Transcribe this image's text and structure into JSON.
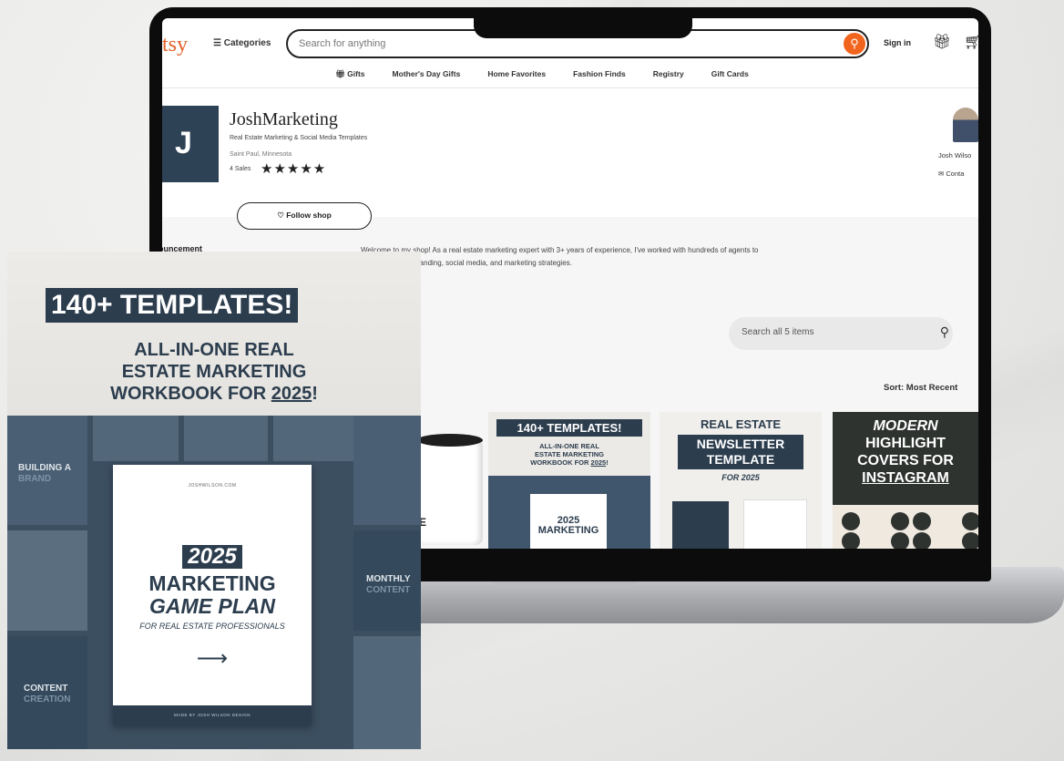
{
  "header": {
    "logo": "tsy",
    "categories_label": "Categories",
    "search_placeholder": "Search for anything",
    "sign_in": "Sign in"
  },
  "nav": {
    "items": [
      "Gifts",
      "Mother's Day Gifts",
      "Home Favorites",
      "Fashion Finds",
      "Registry",
      "Gift Cards"
    ]
  },
  "shop": {
    "logo_letter": "J",
    "name": "JoshMarketing",
    "tagline": "Real Estate Marketing & Social Media Templates",
    "location": "Saint Paul, Minnesota",
    "sales": "4 Sales",
    "stars": "★★★★★",
    "rating": 5,
    "owner_name": "Josh Wilso",
    "contact": "Conta",
    "follow_label": "Follow shop",
    "announcement_label": "ouncement",
    "welcome_line1": "Welcome to my shop! As a real estate marketing expert with 3+ years of experience, I've worked with hundreds of agents to",
    "welcome_line2": "randing, social media, and marketing strategies.",
    "items_search_placeholder": "Search all 5 items",
    "sort_label": "Sort: Most Recent"
  },
  "thumbnails": {
    "t1_title": "140+ TEMPLATES!",
    "t1_sub1": "ALL-IN-ONE REAL",
    "t1_sub2": "ESTATE MARKETING",
    "t1_sub3": "WORKBOOK FOR",
    "t1_year": "2025",
    "t1_excl": "!",
    "t1_doc1": "2025",
    "t1_doc2": "MARKETING",
    "t2_a": "REAL ESTATE",
    "t2_b1": "NEWSLETTER",
    "t2_b2": "TEMPLATE",
    "t2_c": "FOR 2025",
    "t3_a": "MODERN",
    "t3_b1": "HIGHLIGHT",
    "t3_b2": "COVERS FOR",
    "t3_u": "INSTAGRAM",
    "mug_text": "E"
  },
  "card": {
    "headline": "140+ TEMPLATES!",
    "line1": "ALL-IN-ONE REAL",
    "line2": "ESTATE MARKETING",
    "line3_prefix": "WORKBOOK FOR ",
    "line3_year": "2025",
    "line3_suffix": "!",
    "side_building": "BUILDING A",
    "side_brand": "BRAND",
    "side_monthly": "MONTHLY",
    "side_content_r": "CONTENT",
    "side_content_l": "CONTENT",
    "side_creation": "CREATION",
    "paper_site": "JOSHWILSON.COM",
    "paper_year": "2025",
    "paper_marketing": "MARKETING",
    "paper_gameplan": "GAME PLAN",
    "paper_for": "FOR REAL ESTATE PROFESSIONALS",
    "paper_arrow": "⟶",
    "paper_footer": "MADE BY JOSH WILSON DESIGN"
  },
  "icons": {
    "menu": "hamburger-icon",
    "search": "search-icon",
    "gift": "gift-icon",
    "cart": "cart-icon",
    "heart": "heart-icon",
    "mail": "mail-icon"
  },
  "colors": {
    "etsy_orange": "#f1641e",
    "navy": "#2c3d4e"
  }
}
